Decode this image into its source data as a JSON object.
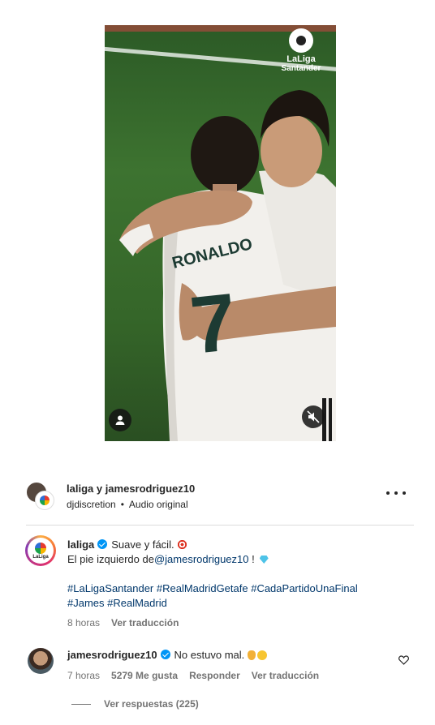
{
  "video": {
    "watermark_line1": "LaLiga",
    "watermark_line2": "Santander",
    "jersey_name": "RONALDO",
    "jersey_number": "7"
  },
  "post_header": {
    "title": "laliga y jamesrodriguez10",
    "music_user": "djdiscretion",
    "audio_label": "Audio original",
    "dot": "•"
  },
  "caption": {
    "username": "laliga",
    "line1_text": "Suave y fácil.",
    "line2_prefix": "El pie izquierdo de",
    "mention": "@jamesrodriguez10",
    "line2_suffix": " !",
    "hashtags_line1": "#LaLigaSantander #RealMadridGetafe #CadaPartidoUnaFinal",
    "hashtags_line2": "#James #RealMadrid",
    "time": "8 horas",
    "translate": "Ver traducción",
    "avatar_text": "LaLiga"
  },
  "comment": {
    "username": "jamesrodriguez10",
    "text": "No estuvo mal.",
    "time": "7 horas",
    "likes": "5279 Me gusta",
    "reply": "Responder",
    "translate": "Ver traducción",
    "view_replies": "Ver respuestas (225)"
  },
  "icons": {
    "user": "user-icon",
    "mute": "muted-speaker-icon",
    "more": "more-options-icon",
    "like": "heart-icon",
    "verified": "verified-badge-icon"
  },
  "colors": {
    "link": "#00376b",
    "verified": "#0095f6",
    "meta": "#737373",
    "text": "#262626"
  }
}
